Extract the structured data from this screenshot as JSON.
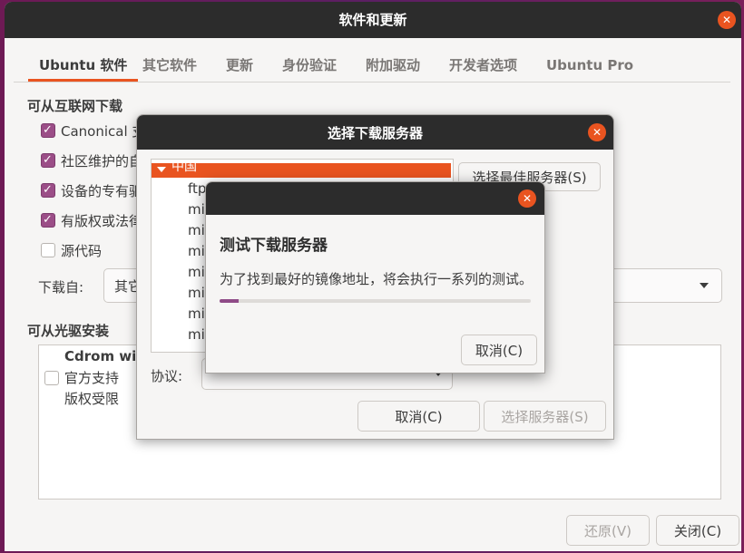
{
  "main_window": {
    "title": "软件和更新",
    "close_glyph": "✕",
    "tabs": [
      {
        "label": "Ubuntu 软件",
        "active": true
      },
      {
        "label": "其它软件"
      },
      {
        "label": "更新"
      },
      {
        "label": "身份验证"
      },
      {
        "label": "附加驱动"
      },
      {
        "label": "开发者选项"
      },
      {
        "label": "Ubuntu Pro"
      }
    ],
    "internet_section": {
      "title": "可从互联网下载",
      "checkboxes": [
        {
          "label": "Canonical 支",
          "checked": true
        },
        {
          "label": "社区维护的自",
          "checked": true
        },
        {
          "label": "设备的专有驱",
          "checked": true
        },
        {
          "label": "有版权或法律",
          "checked": true
        },
        {
          "label": "源代码",
          "checked": false
        }
      ],
      "download_from_label": "下载自:",
      "download_from_value": "其它"
    },
    "cdrom_section": {
      "title": "可从光驱安装",
      "entry_title": "Cdrom with",
      "entry_line1": "官方支持",
      "entry_line2": "版权受限",
      "checked": false
    },
    "revert_button": "还原(V)",
    "close_button": "关闭(C)"
  },
  "server_dialog": {
    "title": "选择下载服务器",
    "close_glyph": "✕",
    "selected_country": "中国",
    "servers": [
      "ftp",
      "mir",
      "mir",
      "mir",
      "mir",
      "mir",
      "mir",
      "mir"
    ],
    "best_server_button": "选择最佳服务器(S)",
    "protocol_label": "协议:",
    "cancel_button": "取消(C)",
    "choose_button": "选择服务器(S)"
  },
  "progress_dialog": {
    "close_glyph": "✕",
    "title": "测试下载服务器",
    "message": "为了找到最好的镜像地址，将会执行一系列的测试。",
    "progress_fraction": 0.06,
    "cancel_button": "取消(C)"
  },
  "colors": {
    "accent": "#e95420",
    "progress": "#8f4b87",
    "checkbox": "#9b4e87",
    "titlebar": "#2c2c2c"
  }
}
